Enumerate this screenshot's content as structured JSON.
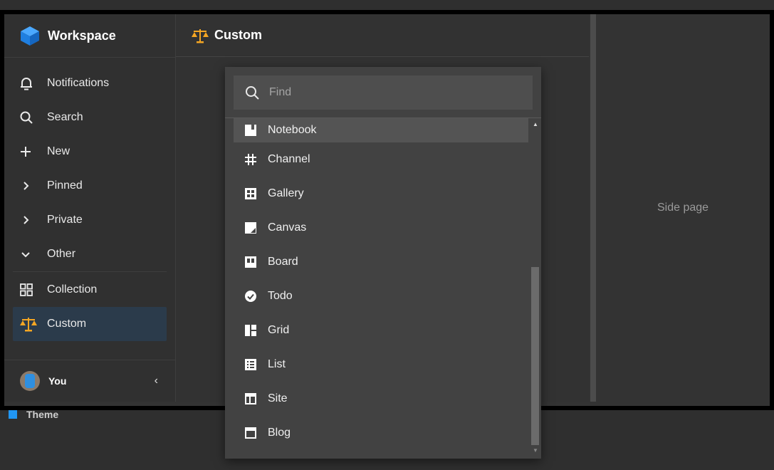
{
  "sidebar": {
    "title": "Workspace",
    "items": [
      {
        "label": "Notifications",
        "icon": "bell-icon"
      },
      {
        "label": "Search",
        "icon": "search-icon"
      },
      {
        "label": "New",
        "icon": "plus-icon"
      },
      {
        "label": "Pinned",
        "icon": "chevron-right-icon"
      },
      {
        "label": "Private",
        "icon": "chevron-right-icon"
      },
      {
        "label": "Other",
        "icon": "chevron-down-icon"
      }
    ],
    "pages": [
      {
        "label": "Collection",
        "icon": "grid-icon"
      },
      {
        "label": "Custom",
        "icon": "scales-icon",
        "active": true
      }
    ],
    "user": "You",
    "collapse_glyph": "‹"
  },
  "main": {
    "title": "Custom",
    "icon": "scales-icon"
  },
  "side_page": {
    "label": "Side page"
  },
  "theme": {
    "label": "Theme",
    "color": "#2196f3"
  },
  "dropdown": {
    "search_placeholder": "Find",
    "items": [
      {
        "label": "Notebook",
        "icon": "notebook-icon",
        "highlighted": true
      },
      {
        "label": "Channel",
        "icon": "hash-icon"
      },
      {
        "label": "Gallery",
        "icon": "gallery-icon"
      },
      {
        "label": "Canvas",
        "icon": "canvas-icon"
      },
      {
        "label": "Board",
        "icon": "board-icon"
      },
      {
        "label": "Todo",
        "icon": "check-circle-icon"
      },
      {
        "label": "Grid",
        "icon": "grid-layout-icon"
      },
      {
        "label": "List",
        "icon": "list-icon"
      },
      {
        "label": "Site",
        "icon": "site-icon"
      },
      {
        "label": "Blog",
        "icon": "blog-icon"
      }
    ]
  },
  "colors": {
    "accent": "#2196f3",
    "active_bg": "#2b3b4b",
    "scales": "#f5a623"
  }
}
